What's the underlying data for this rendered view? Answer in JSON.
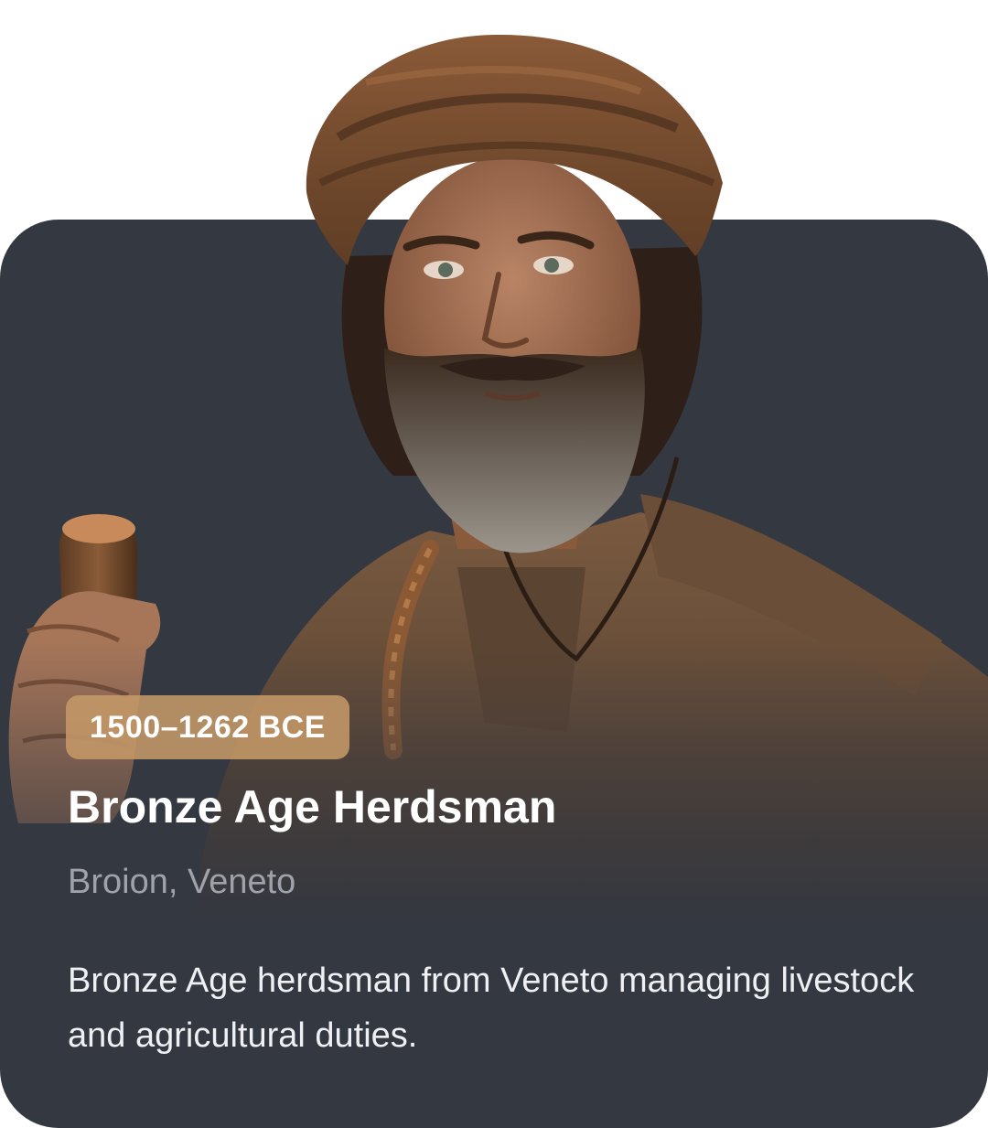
{
  "card": {
    "period": "1500–1262 BCE",
    "title": "Bronze Age Herdsman",
    "location": "Broion, Veneto",
    "description": "Bronze Age herdsman from Veneto managing livestock and agricultural duties."
  },
  "portrait": {
    "subject": "bearded herdsman with brown head wrap holding a wooden staff"
  },
  "colors": {
    "card_background": "#343841",
    "badge_background": "#c49868",
    "title": "#ffffff",
    "subtitle": "#9fa2aa",
    "description": "#eef0f3"
  }
}
